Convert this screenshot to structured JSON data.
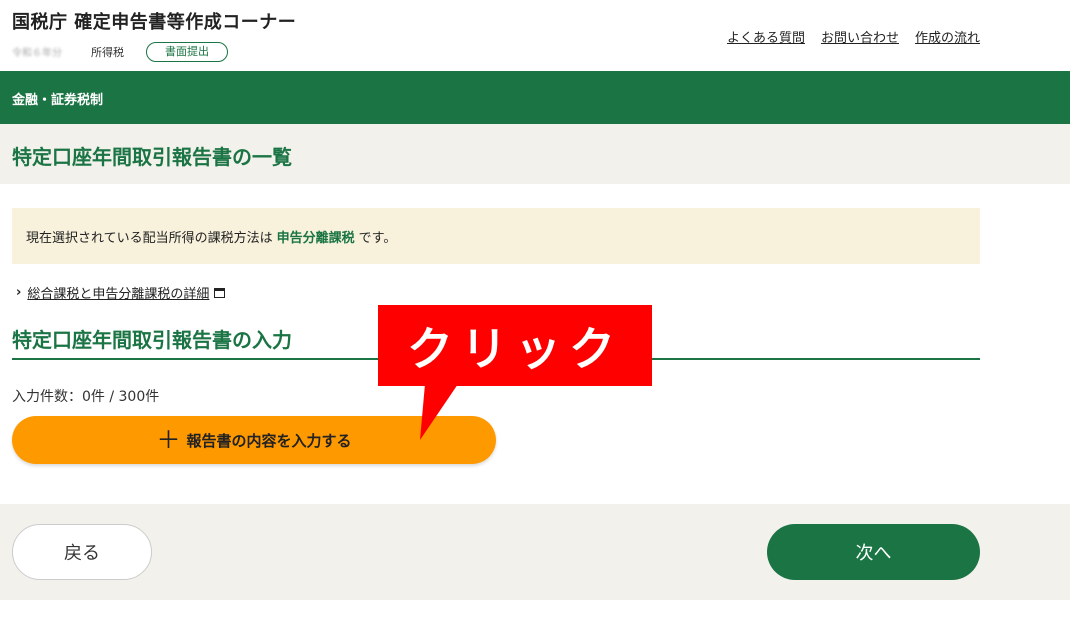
{
  "header": {
    "app_title": "国税庁 確定申告書等作成コーナー",
    "era_label": "令和６年分",
    "tax_type": "所得税",
    "submit_badge": "書面提出",
    "links": [
      "よくある質問",
      "お問い合わせ",
      "作成の流れ"
    ]
  },
  "nav_bar": {
    "label": "金融・証券税制"
  },
  "page": {
    "title": "特定口座年間取引報告書の一覧",
    "notice_prefix": "現在選択されている配当所得の課税方法は",
    "notice_highlight": "申告分離課税",
    "notice_suffix": "です。",
    "detail_link": "総合課税と申告分離課税の詳細"
  },
  "section": {
    "heading": "特定口座年間取引報告書の入力",
    "count_text": "入力件数：0件 / 300件",
    "add_button": "報告書の内容を入力する"
  },
  "annotation": {
    "callout": "クリック"
  },
  "footer": {
    "back": "戻る",
    "next": "次へ"
  },
  "colors": {
    "brand_green": "#1a7443",
    "accent_orange": "#ff9900",
    "callout_red": "#ff0000"
  }
}
